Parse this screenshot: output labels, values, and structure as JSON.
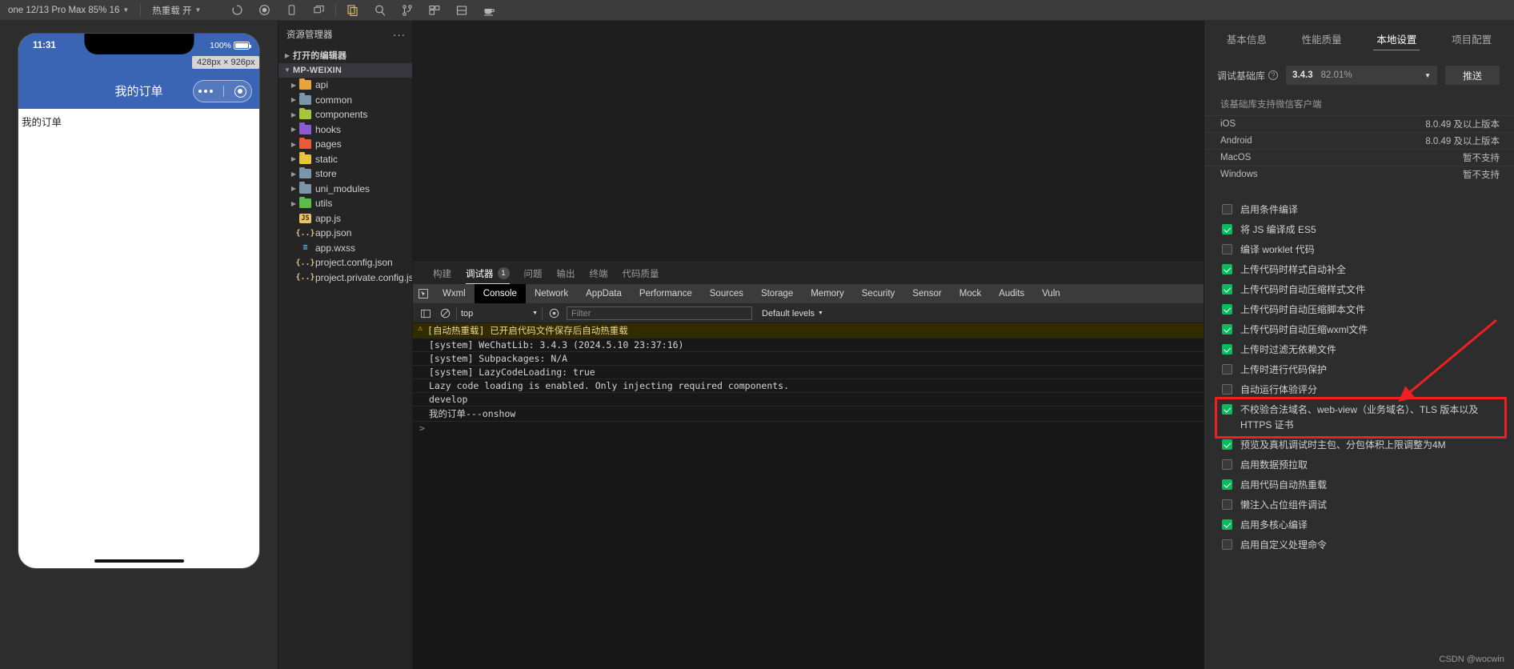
{
  "toolbar": {
    "device_selector": "one 12/13 Pro Max 85% 16",
    "hot_reload_label": "热重载 开",
    "icons": [
      "refresh-icon",
      "stop-record-icon",
      "phone-icon",
      "window-icon",
      "files-icon",
      "search-icon",
      "git-branch-icon",
      "extensions-icon",
      "layout-icon",
      "debug-tea-icon"
    ]
  },
  "simulator": {
    "size_badge": "428px × 926px",
    "status_time": "11:31",
    "battery_pct": "100%",
    "nav_title": "我的订单",
    "page_text": "我的订单"
  },
  "explorer": {
    "title": "资源管理器",
    "more": "···",
    "open_editors": "打开的编辑器",
    "project": "MP-WEIXIN",
    "folders": [
      {
        "name": "api",
        "color": "#e8a33d"
      },
      {
        "name": "common",
        "color": "#7a96a8"
      },
      {
        "name": "components",
        "color": "#a8c63c"
      },
      {
        "name": "hooks",
        "color": "#8b5cd6"
      },
      {
        "name": "pages",
        "color": "#e85b3a"
      },
      {
        "name": "static",
        "color": "#e8c33d"
      },
      {
        "name": "store",
        "color": "#7a96a8"
      },
      {
        "name": "uni_modules",
        "color": "#7a96a8"
      },
      {
        "name": "utils",
        "color": "#5bbd4a"
      }
    ],
    "files": [
      {
        "name": "app.js",
        "kind": "js",
        "glyph": "JS"
      },
      {
        "name": "app.json",
        "kind": "json",
        "glyph": "{..}"
      },
      {
        "name": "app.wxss",
        "kind": "wxss",
        "glyph": "≡"
      },
      {
        "name": "project.config.json",
        "kind": "json",
        "glyph": "{..}"
      },
      {
        "name": "project.private.config.js...",
        "kind": "json",
        "glyph": "{..}"
      }
    ]
  },
  "panel": {
    "tabs": [
      {
        "label": "构建",
        "badge": ""
      },
      {
        "label": "调试器",
        "badge": "1"
      },
      {
        "label": "问题",
        "badge": ""
      },
      {
        "label": "输出",
        "badge": ""
      },
      {
        "label": "终端",
        "badge": ""
      },
      {
        "label": "代码质量",
        "badge": ""
      }
    ],
    "active_tab": "调试器",
    "devtools_tabs": [
      "Wxml",
      "Console",
      "Network",
      "AppData",
      "Performance",
      "Sources",
      "Storage",
      "Memory",
      "Security",
      "Sensor",
      "Mock",
      "Audits",
      "Vuln"
    ],
    "devtools_active": "Console",
    "console_toolbar": {
      "context": "top",
      "filter_placeholder": "Filter",
      "levels": "Default levels"
    },
    "console_lines": [
      {
        "text": "[自动热重载] 已开启代码文件保存后自动热重载",
        "type": "warn"
      },
      {
        "text": "[system] WeChatLib: 3.4.3 (2024.5.10 23:37:16)",
        "type": "log"
      },
      {
        "text": "[system] Subpackages: N/A",
        "type": "log"
      },
      {
        "text": "[system] LazyCodeLoading: true",
        "type": "log"
      },
      {
        "text": "Lazy code loading is enabled. Only injecting required components.",
        "type": "log"
      },
      {
        "text": "develop",
        "type": "log"
      },
      {
        "text": "我的订单---onshow",
        "type": "log"
      },
      {
        "text": ">",
        "type": "prompt"
      }
    ]
  },
  "settings": {
    "tabs": [
      {
        "label": "基本信息"
      },
      {
        "label": "性能质量"
      },
      {
        "label": "本地设置"
      },
      {
        "label": "项目配置"
      }
    ],
    "active_tab": "本地设置",
    "baselib_label": "调试基础库",
    "baselib_version": "3.4.3",
    "baselib_percent": "82.01%",
    "push_button": "推送",
    "support_title": "该基础库支持微信客户端",
    "support_rows": [
      {
        "platform": "iOS",
        "value": "8.0.49 及以上版本"
      },
      {
        "platform": "Android",
        "value": "8.0.49 及以上版本"
      },
      {
        "platform": "MacOS",
        "value": "暂不支持"
      },
      {
        "platform": "Windows",
        "value": "暂不支持"
      }
    ],
    "options": [
      {
        "label": "启用条件编译",
        "checked": false
      },
      {
        "label": "将 JS 编译成 ES5",
        "checked": true
      },
      {
        "label": "编译 worklet 代码",
        "checked": false
      },
      {
        "label": "上传代码时样式自动补全",
        "checked": true
      },
      {
        "label": "上传代码时自动压缩样式文件",
        "checked": true
      },
      {
        "label": "上传代码时自动压缩脚本文件",
        "checked": true
      },
      {
        "label": "上传代码时自动压缩wxml文件",
        "checked": true
      },
      {
        "label": "上传时过滤无依赖文件",
        "checked": true
      },
      {
        "label": "上传时进行代码保护",
        "checked": false
      },
      {
        "label": "自动运行体验评分",
        "checked": false
      },
      {
        "label": "不校验合法域名、web-view（业务域名）、TLS 版本以及 HTTPS 证书",
        "checked": true,
        "highlighted": true
      },
      {
        "label": "预览及真机调试时主包、分包体积上限调整为4M",
        "checked": true
      },
      {
        "label": "启用数据预拉取",
        "checked": false
      },
      {
        "label": "启用代码自动热重载",
        "checked": true
      },
      {
        "label": "懒注入占位组件调试",
        "checked": false
      },
      {
        "label": "启用多核心编译",
        "checked": true
      },
      {
        "label": "启用自定义处理命令",
        "checked": false
      }
    ],
    "accent_green": "#09bb5f",
    "highlight_red": "#f02020"
  },
  "watermark": "CSDN @wocwin"
}
